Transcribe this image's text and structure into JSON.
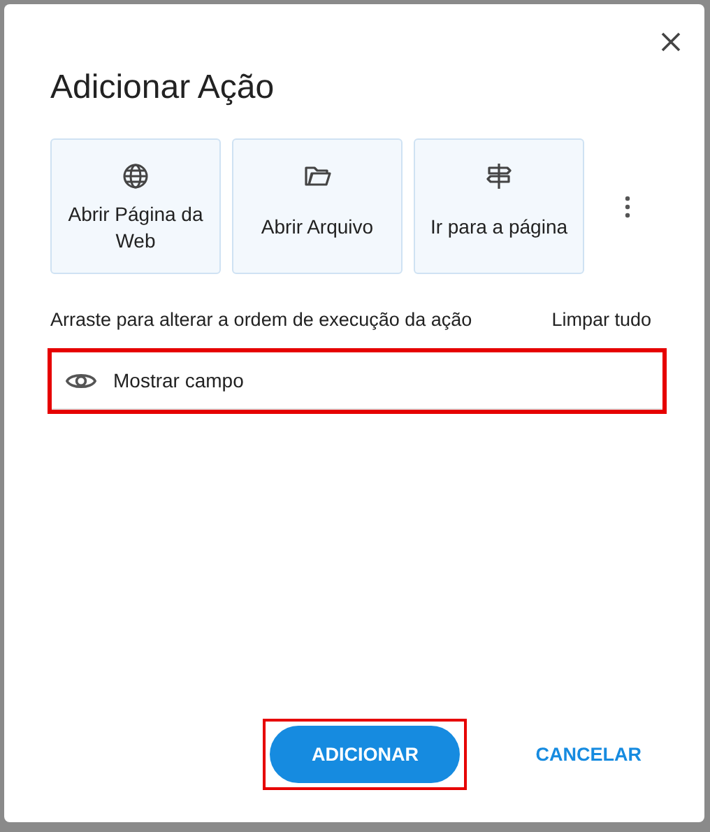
{
  "dialog": {
    "title": "Adicionar Ação",
    "action_types": [
      {
        "label": "Abrir Página da Web",
        "kind": "globe"
      },
      {
        "label": "Abrir Arquivo",
        "kind": "folder"
      },
      {
        "label": "Ir para a página",
        "kind": "signpost"
      }
    ],
    "hint": "Arraste para alterar a ordem de execução da ação",
    "clear_all": "Limpar tudo",
    "actions": [
      {
        "label": "Mostrar campo",
        "kind": "eye",
        "highlighted": true
      }
    ],
    "buttons": [
      {
        "label": "ADICIONAR",
        "kind": "primary",
        "highlighted": true
      },
      {
        "label": "CANCELAR",
        "kind": "text",
        "highlighted": false
      }
    ]
  }
}
